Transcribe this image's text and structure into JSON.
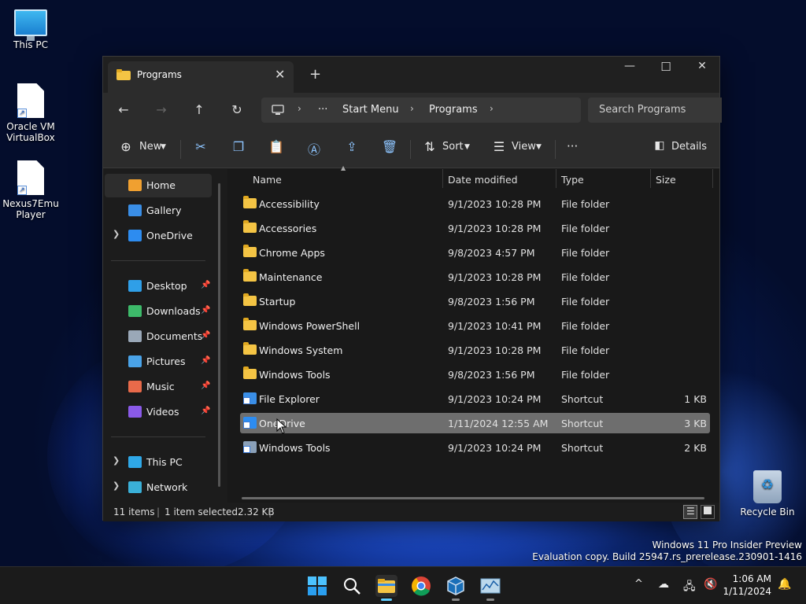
{
  "desktop": {
    "icons": [
      {
        "label": "This PC"
      },
      {
        "label": "Oracle VM VirtualBox"
      },
      {
        "label": "Nexus7Emu Player"
      },
      {
        "label": "Recycle Bin"
      }
    ],
    "watermark": {
      "line1": "Windows 11 Pro Insider Preview",
      "line2": "Evaluation copy. Build 25947.rs_prerelease.230901-1416"
    }
  },
  "window": {
    "tab_title": "Programs",
    "tab_close": "✕",
    "new_tab": "+",
    "controls": {
      "minimize": "—",
      "maximize": "☐",
      "close": "✕"
    },
    "nav": {
      "back": "←",
      "forward": "→",
      "up": "↑",
      "refresh": "↻"
    },
    "address": {
      "ellipsis": "···",
      "segments": [
        "Start Menu",
        "Programs"
      ]
    },
    "search_placeholder": "Search Programs",
    "toolbar": {
      "new_label": "New",
      "sort_label": "Sort",
      "view_label": "View",
      "more_label": "···",
      "details_label": "Details"
    },
    "sidebar": {
      "items": [
        {
          "label": "Home",
          "color": "#f0a030"
        },
        {
          "label": "Gallery",
          "color": "#3a8ee6"
        },
        {
          "label": "OneDrive",
          "color": "#2d8cf0"
        },
        {
          "label": "Desktop",
          "color": "#2f9fe8"
        },
        {
          "label": "Downloads",
          "color": "#3dba6a"
        },
        {
          "label": "Documents",
          "color": "#9aa8b8"
        },
        {
          "label": "Pictures",
          "color": "#4aa3e8"
        },
        {
          "label": "Music",
          "color": "#e86a4a"
        },
        {
          "label": "Videos",
          "color": "#8a5ae8"
        },
        {
          "label": "This PC",
          "color": "#2fa8e8"
        },
        {
          "label": "Network",
          "color": "#3ab0d8"
        }
      ]
    },
    "columns": {
      "name": "Name",
      "date": "Date modified",
      "type": "Type",
      "size": "Size"
    },
    "files": [
      {
        "name": "Accessibility",
        "date": "9/1/2023 10:28 PM",
        "type": "File folder",
        "size": ""
      },
      {
        "name": "Accessories",
        "date": "9/1/2023 10:28 PM",
        "type": "File folder",
        "size": ""
      },
      {
        "name": "Chrome Apps",
        "date": "9/8/2023 4:57 PM",
        "type": "File folder",
        "size": ""
      },
      {
        "name": "Maintenance",
        "date": "9/1/2023 10:28 PM",
        "type": "File folder",
        "size": ""
      },
      {
        "name": "Startup",
        "date": "9/8/2023 1:56 PM",
        "type": "File folder",
        "size": ""
      },
      {
        "name": "Windows PowerShell",
        "date": "9/1/2023 10:41 PM",
        "type": "File folder",
        "size": ""
      },
      {
        "name": "Windows System",
        "date": "9/1/2023 10:28 PM",
        "type": "File folder",
        "size": ""
      },
      {
        "name": "Windows Tools",
        "date": "9/8/2023 1:56 PM",
        "type": "File folder",
        "size": ""
      },
      {
        "name": "File Explorer",
        "date": "9/1/2023 10:24 PM",
        "type": "Shortcut",
        "size": "1 KB"
      },
      {
        "name": "OneDrive",
        "date": "1/11/2024 12:55 AM",
        "type": "Shortcut",
        "size": "3 KB"
      },
      {
        "name": "Windows Tools",
        "date": "9/1/2023 10:24 PM",
        "type": "Shortcut",
        "size": "2 KB"
      }
    ],
    "status": {
      "count": "11 items",
      "selected": "1 item selected",
      "size": "2.32 KB"
    }
  },
  "taskbar": {
    "time": "1:06 AM",
    "date": "1/11/2024",
    "tray_overflow": "^"
  },
  "colors": {
    "accent": "#60cdff",
    "selection": "#6e6e6e",
    "folder": "#f4c444"
  }
}
